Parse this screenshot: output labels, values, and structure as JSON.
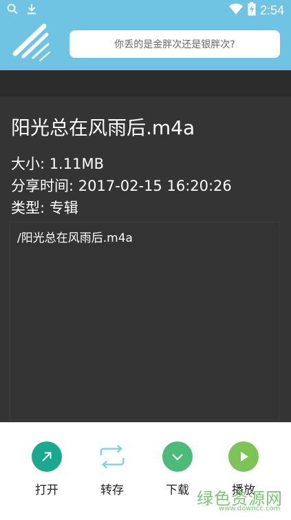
{
  "status_bar": {
    "time": "2:54"
  },
  "search": {
    "text": "你丢的是金胖次还是银胖次?"
  },
  "file": {
    "title": "阳光总在风雨后.m4a",
    "size": "大小: 1.11MB",
    "share_time": "分享时间: 2017-02-15 16:20:26",
    "type": "类型: 专辑",
    "path": "/阳光总在风雨后.m4a"
  },
  "actions": {
    "open": "打开",
    "transfer": "转存",
    "download": "下载",
    "play": "播放"
  },
  "watermark": {
    "text": "绿色资源网",
    "url": "www.downcc.com"
  },
  "colors": {
    "header": "#6fc4e3",
    "open": "#1aa88f",
    "transfer": "#7ed6d0",
    "download": "#4cbb78",
    "play": "#7dc456"
  }
}
